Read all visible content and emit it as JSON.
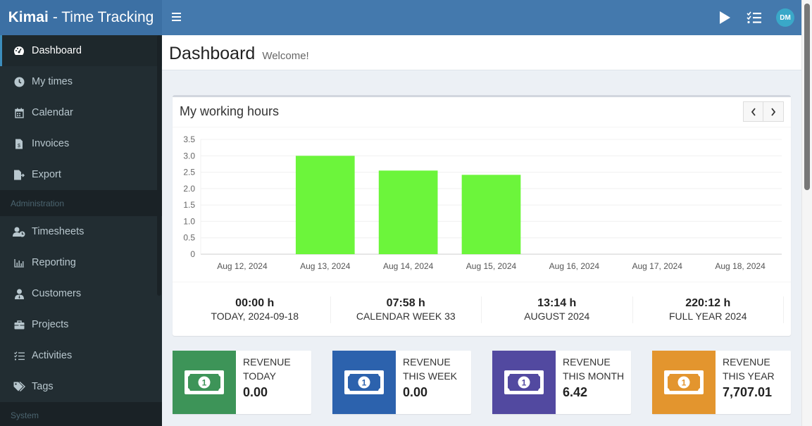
{
  "app": {
    "brand_bold": "Kimai",
    "brand_rest": "- Time Tracking"
  },
  "navbar": {
    "menu_icon": "hamburger-icon",
    "play_icon": "play-icon",
    "tasks_icon": "checklist-icon",
    "avatar_initials": "DM",
    "avatar_color": "#3aa8c8"
  },
  "sidebar": {
    "items": [
      {
        "label": "Dashboard",
        "icon": "tachometer-icon",
        "active": true
      },
      {
        "label": "My times",
        "icon": "clock-icon"
      },
      {
        "label": "Calendar",
        "icon": "calendar-icon"
      },
      {
        "label": "Invoices",
        "icon": "invoice-icon"
      },
      {
        "label": "Export",
        "icon": "export-icon"
      }
    ],
    "admin_header": "Administration",
    "admin_items": [
      {
        "label": "Timesheets",
        "icon": "user-clock-icon"
      },
      {
        "label": "Reporting",
        "icon": "chart-bar-icon"
      },
      {
        "label": "Customers",
        "icon": "user-tie-icon"
      },
      {
        "label": "Projects",
        "icon": "briefcase-icon"
      },
      {
        "label": "Activities",
        "icon": "tasks-icon"
      },
      {
        "label": "Tags",
        "icon": "tags-icon"
      }
    ],
    "system_header": "System"
  },
  "page": {
    "title": "Dashboard",
    "subtitle": "Welcome!"
  },
  "working_hours": {
    "title": "My working hours",
    "prev_icon": "chevron-left-icon",
    "next_icon": "chevron-right-icon",
    "stats": [
      {
        "value": "00:00 h",
        "label": "TODAY, 2024-09-18"
      },
      {
        "value": "07:58 h",
        "label": "CALENDAR WEEK 33"
      },
      {
        "value": "13:14 h",
        "label": "AUGUST 2024"
      },
      {
        "value": "220:12 h",
        "label": "FULL YEAR 2024"
      }
    ]
  },
  "chart_data": {
    "type": "bar",
    "title": "My working hours",
    "categories": [
      "Aug 12, 2024",
      "Aug 13, 2024",
      "Aug 14, 2024",
      "Aug 15, 2024",
      "Aug 16, 2024",
      "Aug 17, 2024",
      "Aug 18, 2024"
    ],
    "values": [
      0,
      3.0,
      2.55,
      2.42,
      0,
      0,
      0
    ],
    "ylim": [
      0,
      3.5
    ],
    "yticks": [
      "0",
      "0.5",
      "1.0",
      "1.5",
      "2.0",
      "2.5",
      "3.0",
      "3.5"
    ],
    "xlabel": "",
    "ylabel": "",
    "grid": true,
    "bar_color": "#6cf53b"
  },
  "revenue": [
    {
      "label_1": "REVENUE",
      "label_2": "TODAY",
      "value": "0.00",
      "color": "#3d9458",
      "icon": "money-bill-icon"
    },
    {
      "label_1": "REVENUE",
      "label_2": "THIS WEEK",
      "value": "0.00",
      "color": "#2c62ad",
      "icon": "money-bill-icon"
    },
    {
      "label_1": "REVENUE",
      "label_2": "THIS MONTH",
      "value": "6.42",
      "color": "#5249a0",
      "icon": "money-bill-icon"
    },
    {
      "label_1": "REVENUE",
      "label_2": "THIS YEAR",
      "value": "7,707.01",
      "color": "#e3952e",
      "icon": "money-bill-icon"
    }
  ]
}
